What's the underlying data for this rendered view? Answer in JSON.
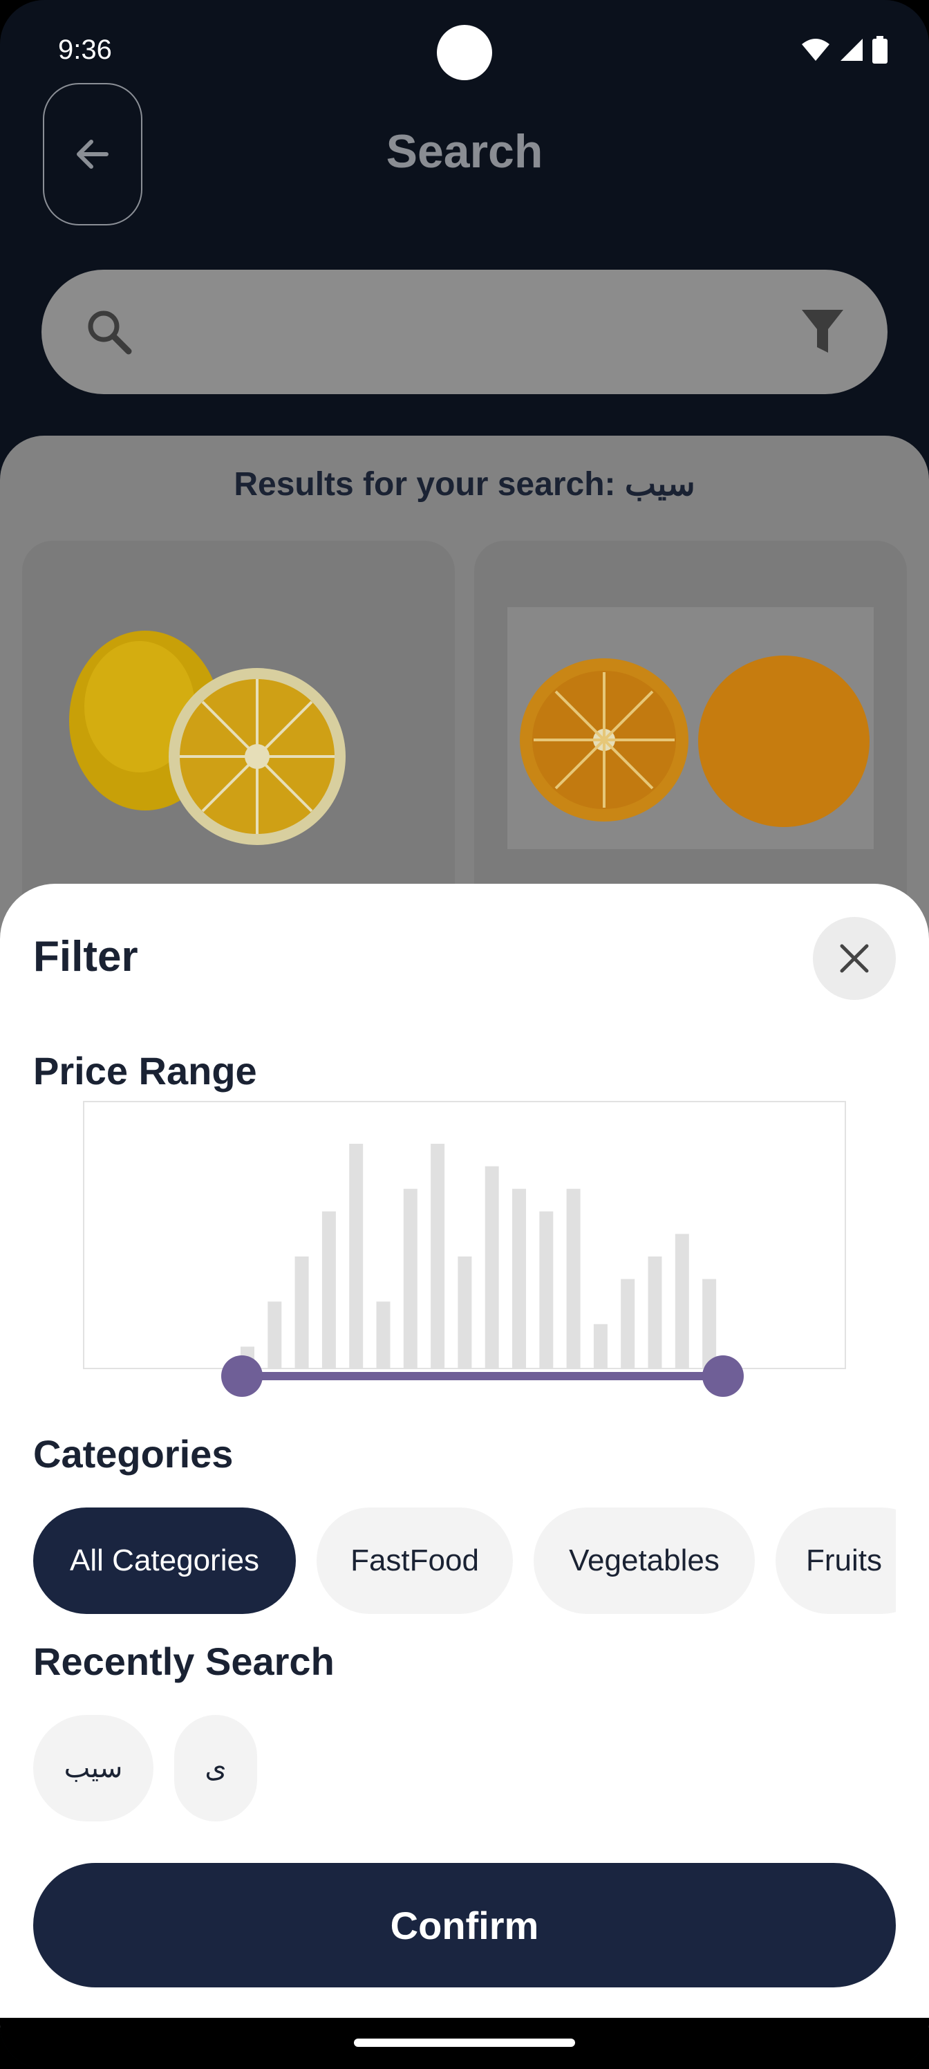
{
  "status_bar": {
    "time": "9:36"
  },
  "header": {
    "title": "Search"
  },
  "search": {
    "value": ""
  },
  "results": {
    "title": "Results for your search: سیب",
    "cards": [
      {
        "image": "lemon-image"
      },
      {
        "image": "orange-image"
      }
    ]
  },
  "filter_sheet": {
    "title": "Filter",
    "price_range": {
      "label": "Price Range",
      "histogram": [
        1,
        3,
        5,
        7,
        10,
        3,
        8,
        10,
        5,
        9,
        8,
        7,
        8,
        2,
        4,
        5,
        6,
        4
      ],
      "range_min": 0,
      "range_max": 1,
      "selected_low": 0.0,
      "selected_high": 1.0,
      "accent_color": "#6f5f97"
    },
    "categories": {
      "label": "Categories",
      "items": [
        "All Categories",
        "FastFood",
        "Vegetables",
        "Fruits"
      ],
      "selected": "All Categories"
    },
    "recent": {
      "label": "Recently Search",
      "items": [
        "سیب",
        "ی"
      ]
    },
    "confirm_label": "Confirm"
  },
  "colors": {
    "primary": "#1a2540",
    "chip_bg": "#f3f3f3",
    "bar": "#e0e0e0"
  }
}
